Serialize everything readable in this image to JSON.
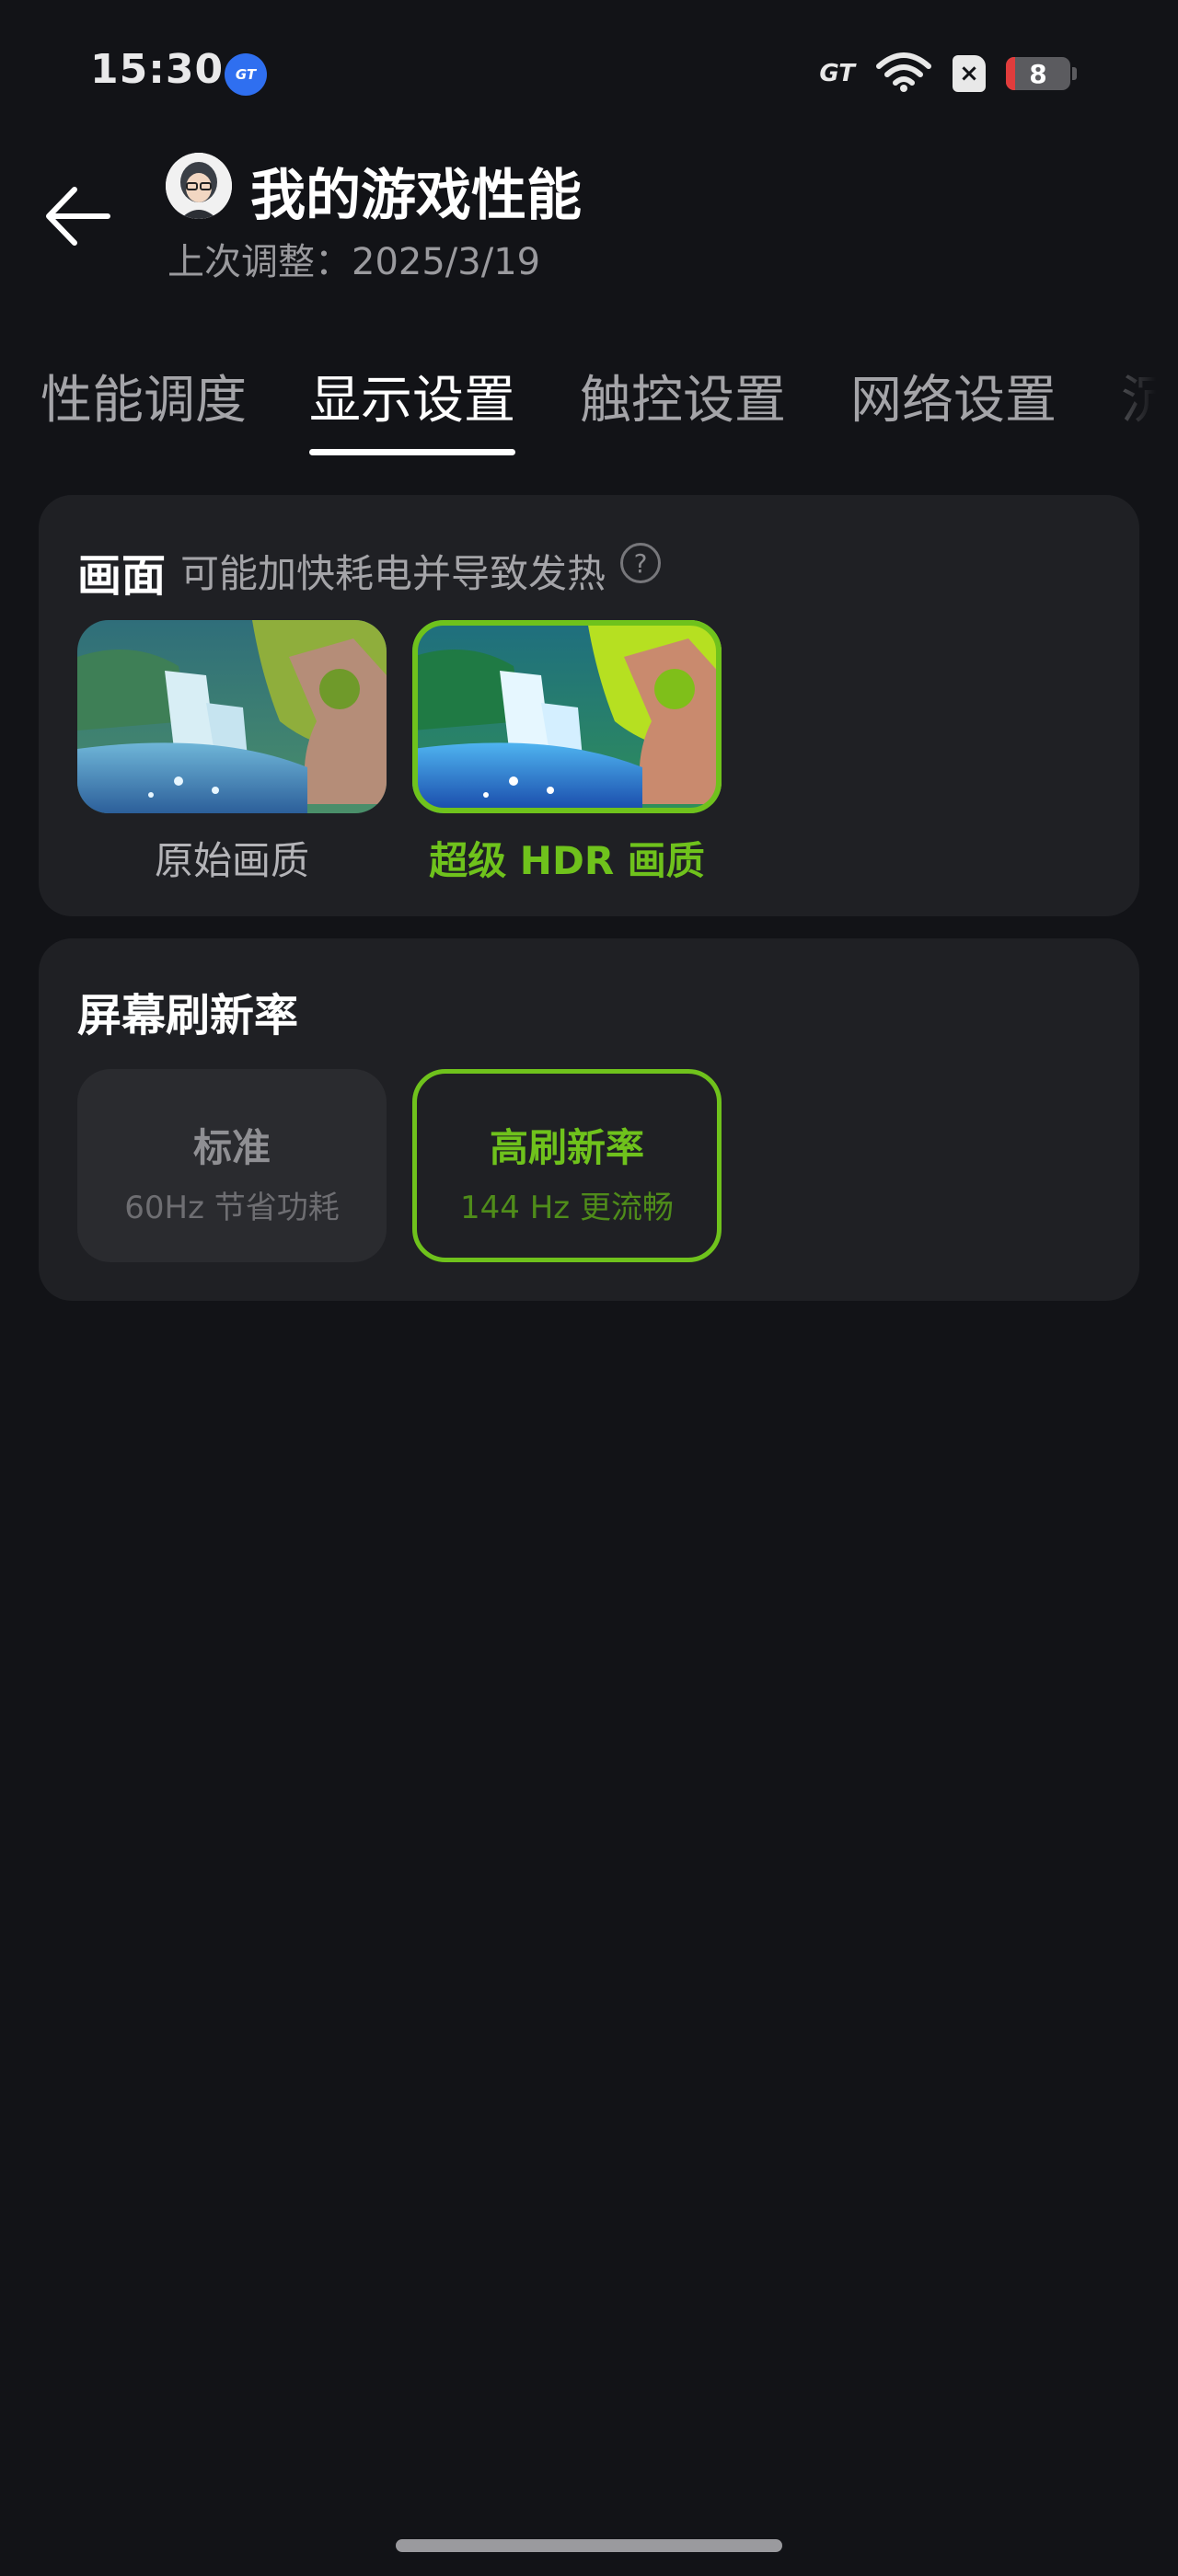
{
  "status_bar": {
    "time": "15:30",
    "gt_badge": "GT",
    "gt_logo": "GT",
    "sim_icon": "×",
    "battery_level": "8",
    "icons": [
      "gt-app-icon",
      "gt-mode-icon",
      "wifi-icon",
      "sim-icon",
      "battery-icon"
    ]
  },
  "header": {
    "back_icon": "arrow-left-icon",
    "title": "我的游戏性能",
    "subtitle": "上次调整：2025/3/19"
  },
  "tabs": [
    {
      "label": "性能调度",
      "active": false
    },
    {
      "label": "显示设置",
      "active": true
    },
    {
      "label": "触控设置",
      "active": false
    },
    {
      "label": "网络设置",
      "active": false
    },
    {
      "label": "沉",
      "active": false
    }
  ],
  "picture_card": {
    "title": "画面",
    "hint": "可能加快耗电并导致发热",
    "help_icon": "?",
    "options": [
      {
        "label": "原始画质",
        "selected": false
      },
      {
        "label": "超级 HDR 画质",
        "selected": true
      }
    ]
  },
  "refresh_card": {
    "title": "屏幕刷新率",
    "options": [
      {
        "name": "标准",
        "desc": "60Hz 节省功耗",
        "selected": false
      },
      {
        "name": "高刷新率",
        "desc": "144 Hz 更流畅",
        "selected": true
      }
    ]
  },
  "colors": {
    "background": "#121317",
    "card": "#1f2024",
    "accent_green": "#6fc21c",
    "text_secondary": "#a4a4a8"
  }
}
